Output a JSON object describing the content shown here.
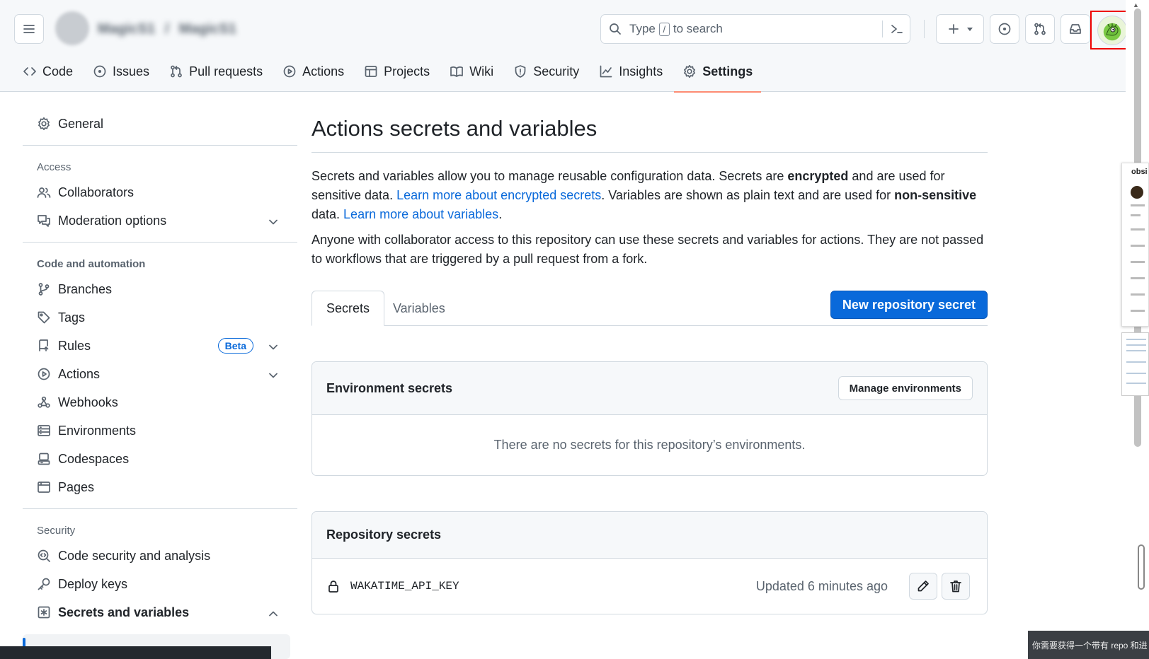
{
  "header": {
    "repo_owner": "MagicS1",
    "repo_name": "MagicS1",
    "search": {
      "prefix": "Type",
      "key": "/",
      "suffix": "to search"
    }
  },
  "repo_tabs": [
    {
      "label": "Code",
      "icon": "code-icon"
    },
    {
      "label": "Issues",
      "icon": "issue-opened-icon"
    },
    {
      "label": "Pull requests",
      "icon": "git-pull-request-icon"
    },
    {
      "label": "Actions",
      "icon": "play-icon"
    },
    {
      "label": "Projects",
      "icon": "table-icon"
    },
    {
      "label": "Wiki",
      "icon": "book-icon"
    },
    {
      "label": "Security",
      "icon": "shield-icon"
    },
    {
      "label": "Insights",
      "icon": "graph-icon"
    },
    {
      "label": "Settings",
      "icon": "gear-icon",
      "active": true
    }
  ],
  "sidebar": {
    "general": "General",
    "access_heading": "Access",
    "access": [
      "Collaborators",
      "Moderation options"
    ],
    "code_heading": "Code and automation",
    "code": [
      "Branches",
      "Tags",
      "Rules",
      "Actions",
      "Webhooks",
      "Environments",
      "Codespaces",
      "Pages"
    ],
    "beta_label": "Beta",
    "security_heading": "Security",
    "security": [
      "Code security and analysis",
      "Deploy keys",
      "Secrets and variables"
    ]
  },
  "main": {
    "title": "Actions secrets and variables",
    "intro_1": "Secrets and variables allow you to manage reusable configuration data. Secrets are ",
    "intro_bold_1": "encrypted",
    "intro_2": " and are used for sensitive data. ",
    "link_secrets": "Learn more about encrypted secrets",
    "intro_3": ". Variables are shown as plain text and are used for ",
    "intro_bold_2": "non-sensitive",
    "intro_4": " data. ",
    "link_variables": "Learn more about variables",
    "intro_5": ".",
    "access_note": "Anyone with collaborator access to this repository can use these secrets and variables for actions. They are not passed to workflows that are triggered by a pull request from a fork.",
    "tabs": [
      "Secrets",
      "Variables"
    ],
    "new_secret_button": "New repository secret",
    "env_section": {
      "title": "Environment secrets",
      "button": "Manage environments",
      "empty": "There are no secrets for this repository’s environments."
    },
    "repo_section": {
      "title": "Repository secrets",
      "secrets": [
        {
          "name": "WAKATIME_API_KEY",
          "updated": "Updated 6 minutes ago"
        }
      ]
    }
  },
  "overlay": {
    "side_title": "obsi",
    "toast": "你需要获得一个带有 repo 和进"
  },
  "colors": {
    "accent": "#0969da",
    "active_tab_underline": "#fd8c73"
  }
}
